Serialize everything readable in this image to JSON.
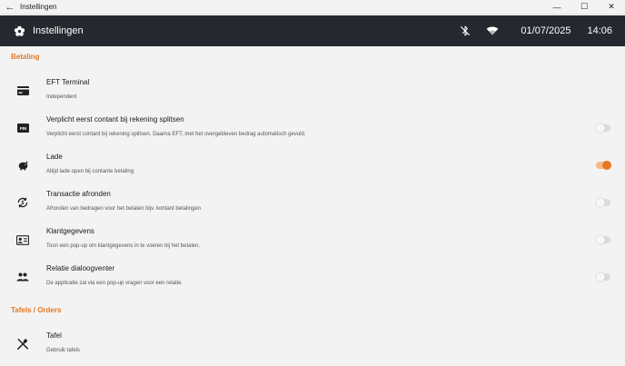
{
  "window": {
    "title": "Instellingen",
    "back_glyph": "←",
    "minimize_glyph": "—",
    "maximize_glyph": "☐",
    "close_glyph": "✕"
  },
  "header": {
    "title": "Instellingen",
    "date": "01/07/2025",
    "time": "14:06",
    "icons": [
      "settings-flower-icon",
      "bluetooth-off-icon",
      "wifi-icon"
    ]
  },
  "colors": {
    "accent": "#e87722",
    "header_bg": "#25282e",
    "page_bg": "#f3f3f3"
  },
  "sections": [
    {
      "title": "Betaling",
      "items": [
        {
          "icon": "credit-card-icon",
          "title": "EFT Terminal",
          "description": "Independent",
          "has_toggle": false
        },
        {
          "icon": "pin-icon",
          "title": "Verplicht eerst contant bij rekening splitsen",
          "description": "Verplicht eerst contant bij rekening splitsen. Daarna EFT, met het overgebleven bedrag automatisch gevuld.",
          "has_toggle": true,
          "toggle_on": false
        },
        {
          "icon": "piggy-bank-icon",
          "title": "Lade",
          "description": "Altijd lade open bij contante betaling",
          "has_toggle": true,
          "toggle_on": true
        },
        {
          "icon": "currency-exchange-icon",
          "title": "Transactie afronden",
          "description": "Afronden van bedragen voor het betalen bijv. kontant betalingen",
          "has_toggle": true,
          "toggle_on": false
        },
        {
          "icon": "contact-card-icon",
          "title": "Klantgegevens",
          "description": "Toon een pop-up om klantgegevens in te voeren bij het betalen.",
          "has_toggle": true,
          "toggle_on": false
        },
        {
          "icon": "people-icon",
          "title": "Relatie dialoogventer",
          "description": "De applicatie zal via een pop-up vragen voor een relatie.",
          "has_toggle": true,
          "toggle_on": false
        }
      ]
    },
    {
      "title": "Tafels / Orders",
      "items": [
        {
          "icon": "cutlery-icon",
          "title": "Tafel",
          "description": "Gebruik tafels",
          "has_toggle": false
        }
      ]
    }
  ]
}
